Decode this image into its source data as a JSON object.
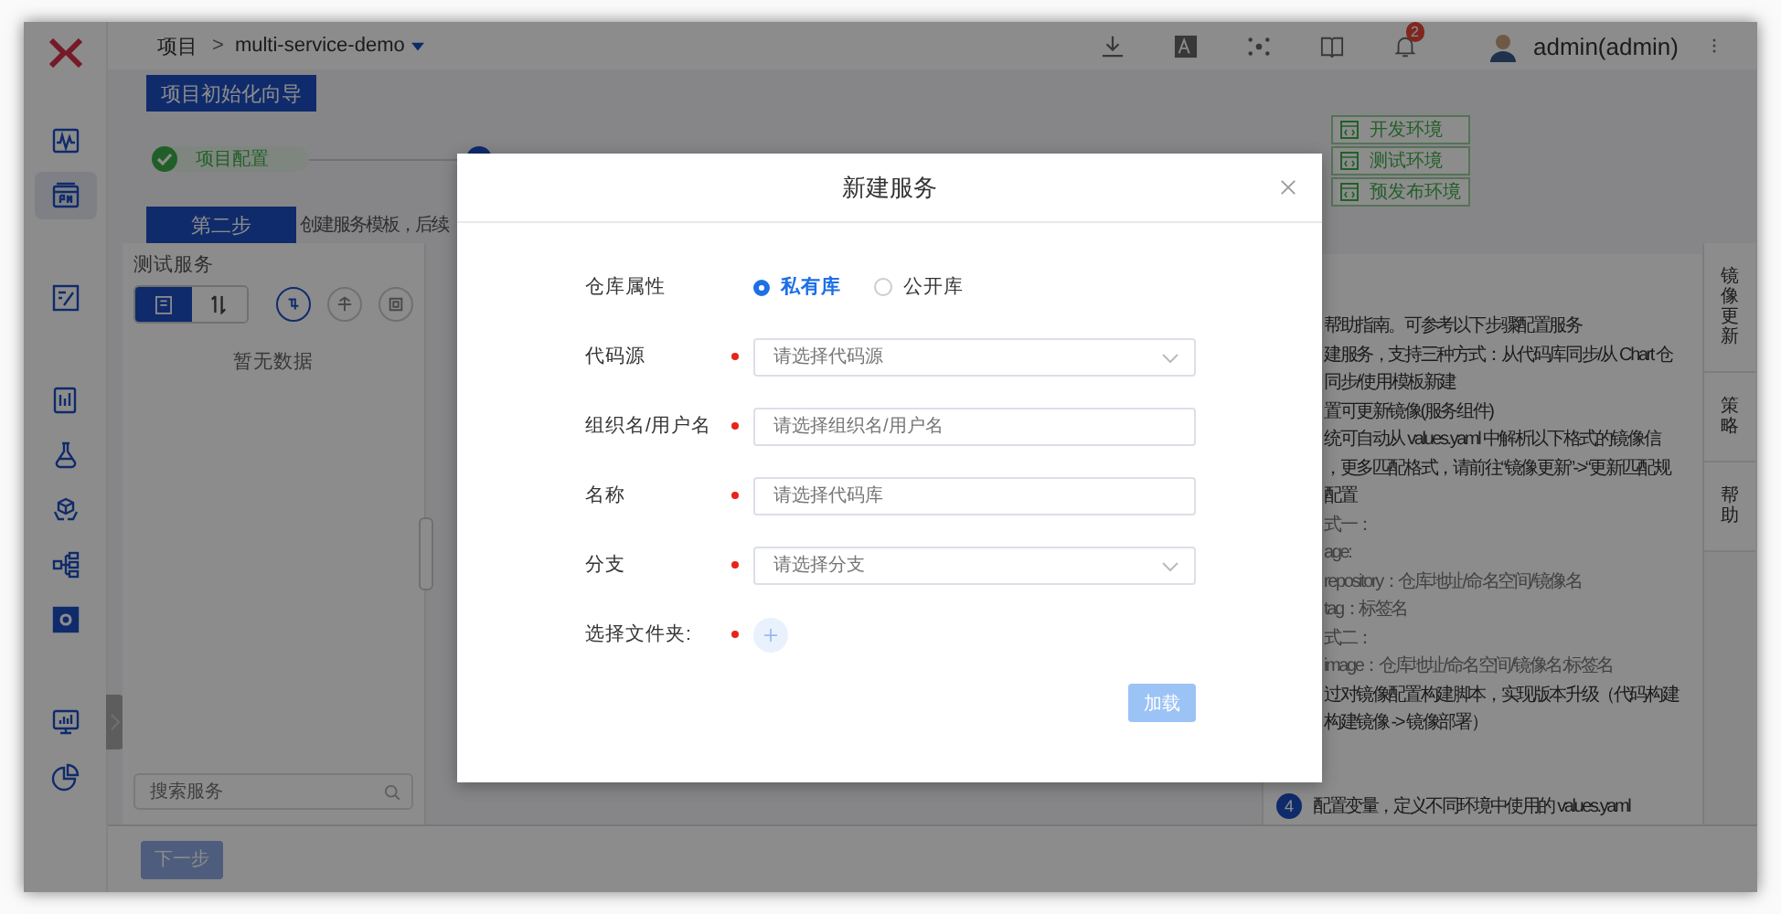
{
  "sidebar": {
    "groups": [
      [
        {
          "selected": false
        },
        {
          "selected": true
        }
      ],
      [
        {
          "selected": false
        }
      ],
      [
        {
          "selected": false
        },
        {
          "selected": false
        },
        {
          "selected": false
        },
        {
          "selected": false
        },
        {
          "selected": false
        }
      ],
      [
        {
          "selected": false
        },
        {
          "selected": false
        }
      ]
    ]
  },
  "topbar": {
    "root": "项目",
    "separator": ">",
    "project": "multi-service-demo",
    "notification_count": "2",
    "user": "admin(admin)"
  },
  "wizard": {
    "button": "项目初始化向导",
    "steps": [
      {
        "label": "项目配置",
        "done": true
      },
      {
        "done": false
      }
    ]
  },
  "environments": [
    "开发环境",
    "测试环境",
    "预发布环境"
  ],
  "step_tab": {
    "label": "第二步",
    "description": "创建服务模板，后续"
  },
  "services_panel": {
    "title": "测试服务",
    "view_toggle": [
      {
        "selected": true
      },
      {
        "selected": false
      }
    ],
    "filters": [
      {
        "selected": true
      },
      {
        "selected": false
      },
      {
        "selected": false
      }
    ],
    "empty_text": "暂无数据",
    "search_placeholder": "搜索服务"
  },
  "next_button": {
    "label": "下一步",
    "disabled": true
  },
  "help": {
    "lines": [
      {
        "kind": "text",
        "text": "帮助指南。可参考以下步骤配置服务"
      },
      {
        "kind": "text",
        "text": "建服务，支持三种方式：从代码库同步/从 Chart 仓"
      },
      {
        "kind": "text",
        "text": "同步/使用模板新建"
      },
      {
        "kind": "text",
        "text": "置可更新镜像(服务组件)"
      },
      {
        "kind": "text",
        "text": "统可自动从 values.yaml 中解析以下格式的镜像信"
      },
      {
        "kind": "text",
        "text": "，更多匹配格式，请前往“镜像更新”->“更新匹配规"
      },
      {
        "kind": "text",
        "text": "配置"
      },
      {
        "kind": "code",
        "text": "式一："
      },
      {
        "kind": "code",
        "text": "age:"
      },
      {
        "kind": "code",
        "text": "repository：仓库地址/命名空间/镜像名"
      },
      {
        "kind": "code",
        "text": "tag：标签名"
      },
      {
        "kind": "code",
        "text": "式二："
      },
      {
        "kind": "code",
        "text": "image：仓库地址/命名空间/镜像名:标签名"
      },
      {
        "kind": "text",
        "text": "过对镜像配置构建脚本，实现版本升级（代码构建"
      },
      {
        "kind": "text",
        "text": "构建镜像 -> 镜像部署）"
      }
    ],
    "step": {
      "number": "4",
      "text": "配置变量，定义不同环境中使用的 values.yaml"
    }
  },
  "side_tabs": [
    "镜像更新",
    "策略",
    "帮助"
  ],
  "dialog": {
    "title": "新建服务",
    "repo_type": {
      "label": "仓库属性",
      "options": [
        {
          "label": "私有库",
          "selected": true
        },
        {
          "label": "公开库",
          "selected": false
        }
      ]
    },
    "fields": [
      {
        "kind": "select",
        "label": "代码源",
        "placeholder": "请选择代码源",
        "required": true
      },
      {
        "kind": "input",
        "label": "组织名/用户名",
        "placeholder": "请选择组织名/用户名",
        "required": true
      },
      {
        "kind": "input",
        "label": "名称",
        "placeholder": "请选择代码库",
        "required": true
      },
      {
        "kind": "select",
        "label": "分支",
        "placeholder": "请选择分支",
        "required": true
      },
      {
        "kind": "upload",
        "label": "选择文件夹:",
        "required": true
      }
    ],
    "submit": {
      "label": "加载",
      "disabled": true
    }
  }
}
